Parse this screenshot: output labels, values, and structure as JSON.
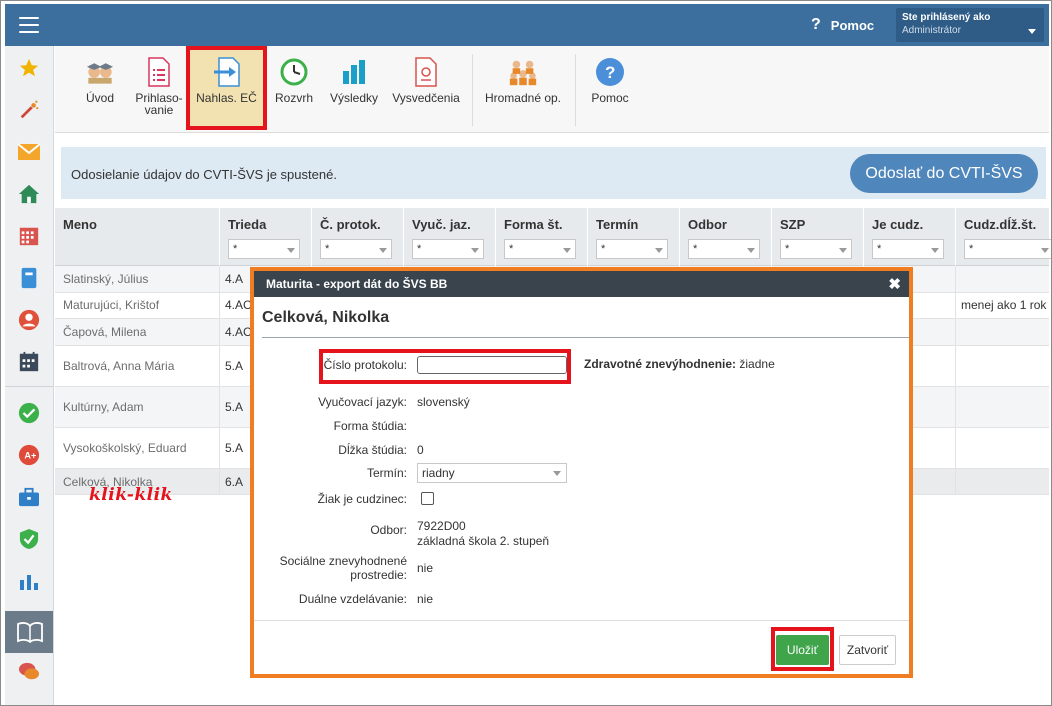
{
  "topbar": {
    "help_label": "Pomoc",
    "user_line1": "Ste prihlásený ako",
    "user_line2": "Administrátor"
  },
  "toolbar": {
    "items": [
      {
        "label": "Úvod"
      },
      {
        "label": "Prihlaso-\nvanie"
      },
      {
        "label": "Nahlas. EČ"
      },
      {
        "label": "Rozvrh"
      },
      {
        "label": "Výsledky"
      },
      {
        "label": "Vysvedčenia"
      },
      {
        "label": "Hromadné op."
      },
      {
        "label": "Pomoc"
      }
    ]
  },
  "info": {
    "text": "Odosielanie údajov do CVTI-ŠVS je spustené.",
    "send_button": "Odoslať do CVTI-ŠVS"
  },
  "table": {
    "columns": [
      "Meno",
      "Trieda",
      "Č. protok.",
      "Vyuč. jaz.",
      "Forma št.",
      "Termín",
      "Odbor",
      "SZP",
      "Je cudz.",
      "Cudz.dĺž.št."
    ],
    "filter_value": "*",
    "rows": [
      {
        "name": "Slatinský, Július",
        "class": "4.A",
        "extra": ""
      },
      {
        "name": "Maturujúci, Krištof",
        "class": "4.AC",
        "extra": "menej ako 1 rok"
      },
      {
        "name": "Čapová, Milena",
        "class": "4.AC",
        "extra": ""
      },
      {
        "name": "Baltrová, Anna Mária",
        "class": "5.A",
        "extra": ""
      },
      {
        "name": "Kultúrny, Adam",
        "class": "5.A",
        "extra": ""
      },
      {
        "name": "Vysokoškolský, Eduard",
        "class": "5.A",
        "extra": ""
      },
      {
        "name": "Celková, Nikolka",
        "class": "6.A",
        "extra": ""
      }
    ]
  },
  "annotation": "klik-klik",
  "modal": {
    "header": "Maturita - export dát do ŠVS BB",
    "close_glyph": "✖",
    "student": "Celková, Nikolka",
    "protocol_label": "Číslo protokolu:",
    "protocol_value": "",
    "health_label": "Zdravotné znevýhodnenie:",
    "health_value": "žiadne",
    "language_label": "Vyučovací jazyk:",
    "language_value": "slovenský",
    "form_label": "Forma štúdia:",
    "form_value": "",
    "length_label": "Dĺžka štúdia:",
    "length_value": "0",
    "term_label": "Termín:",
    "term_value": "riadny",
    "foreigner_label": "Žiak je cudzinec:",
    "foreigner_checked": false,
    "field_label": "Odbor:",
    "field_code": "7922D00",
    "field_name": "základná škola 2. stupeň",
    "social_label_1": "Sociálne znevyhodnené",
    "social_label_2": "prostredie:",
    "social_value": "nie",
    "dual_label": "Duálne vzdelávanie:",
    "dual_value": "nie",
    "save_button": "Uložiť",
    "close_button": "Zatvoriť"
  },
  "colors": {
    "topbar": "#3c6e9e",
    "highlight_red": "#e5141c",
    "modal_border": "#f07d22",
    "save_green": "#3fa44a"
  }
}
